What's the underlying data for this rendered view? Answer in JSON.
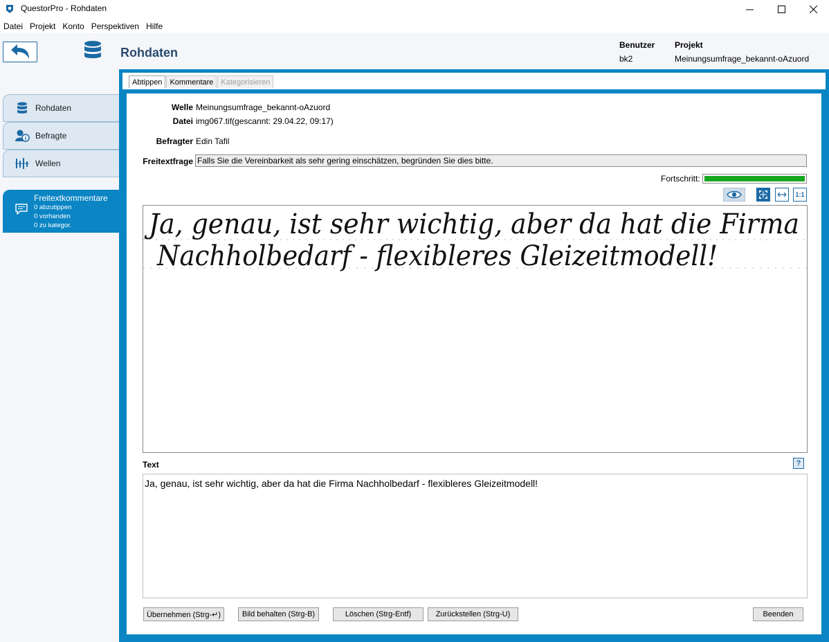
{
  "window": {
    "title": "QuestorPro - Rohdaten",
    "colors": {
      "accent": "#0b85c4",
      "title": "#2a4a6e",
      "progress": "#17a81f"
    }
  },
  "menu": [
    "Datei",
    "Projekt",
    "Konto",
    "Perspektiven",
    "Hilfe"
  ],
  "header": {
    "title": "Rohdaten",
    "user_label": "Benutzer",
    "user_value": "bk2",
    "project_label": "Projekt",
    "project_value": "Meinungsumfrage_bekannt-oAzuord"
  },
  "sidebar": {
    "items": [
      {
        "label": "Rohdaten",
        "icon": "database-icon"
      },
      {
        "label": "Befragte",
        "icon": "person-info-icon"
      },
      {
        "label": "Wellen",
        "icon": "waves-icon"
      }
    ],
    "active": {
      "title": "Freitextkommentare",
      "lines": [
        "0 abzutippen",
        "0 vorhanden",
        "0 zu kategor."
      ],
      "icon": "chat-icon"
    }
  },
  "tabs": [
    "Abtippen",
    "Kommentare",
    "Kategorisieren"
  ],
  "form": {
    "welle_label": "Welle",
    "welle_value": "Meinungsumfrage_bekannt-oAzuord",
    "datei_label": "Datei",
    "datei_value": "img067.tif(gescannt: 29.04.22, 09:17)",
    "befragter_label": "Befragter",
    "befragter_value": "Edin Tafil",
    "frage_label": "Freitextfrage",
    "frage_value": "Falls Sie die Vereinbarkeit als sehr gering einschätzen, begründen Sie dies bitte.",
    "progress_label": "Fortschritt:",
    "progress_fraction": 1.0,
    "zoom_1to1": "1:1",
    "handwriting_line1": "Ja, genau, ist sehr wichtig, aber da hat die Firma",
    "handwriting_line2": "Nachholbedarf - flexibleres Gleizeitmodell!",
    "text_label": "Text",
    "help_label": "?",
    "text_value": "Ja, genau, ist sehr wichtig, aber da hat die Firma Nachholbedarf - flexibleres Gleizeitmodell!"
  },
  "buttons": {
    "uebernehmen": "Übernehmen (Strg-↵)",
    "bild": "Bild behalten (Strg-B)",
    "loeschen": "Löschen (Strg-Entf)",
    "zurueck": "Zurückstellen (Strg-U)",
    "beenden": "Beenden"
  }
}
